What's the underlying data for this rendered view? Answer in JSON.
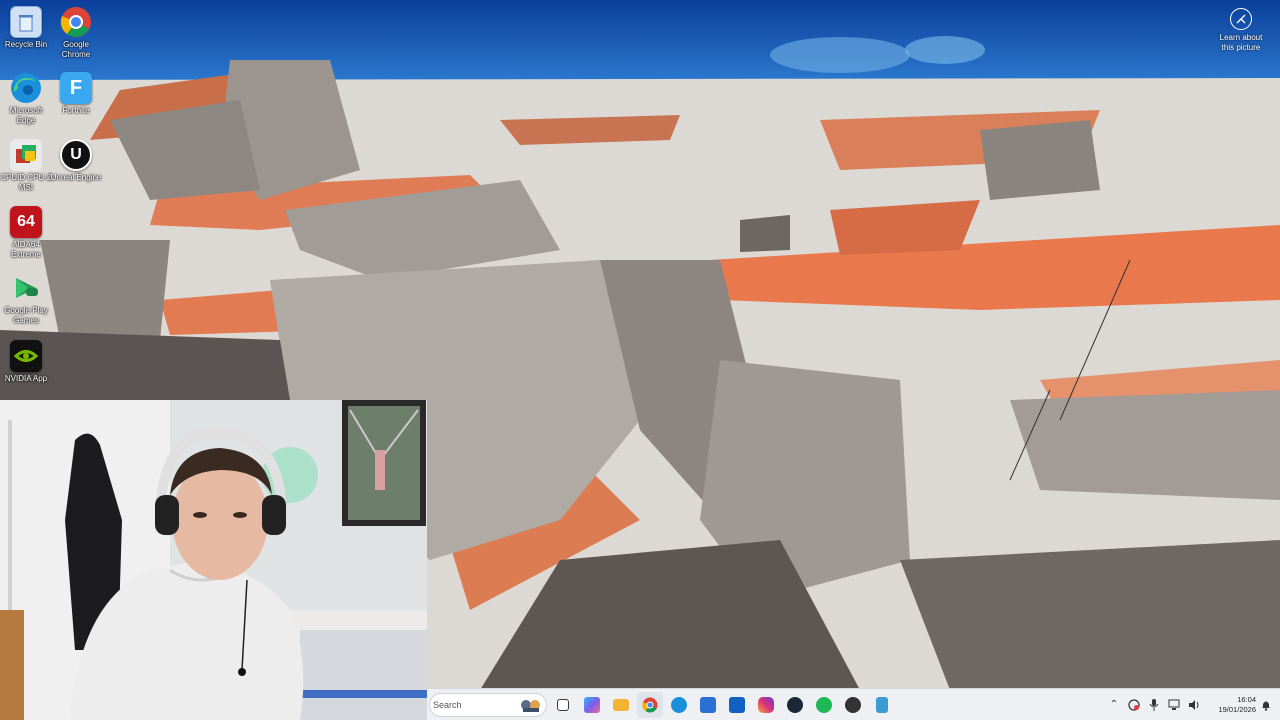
{
  "desktop": {
    "icons": [
      {
        "label": "Recycle Bin",
        "icon": "recycle-bin-icon",
        "color": "#5a8fd6"
      },
      {
        "label": "Google Chrome",
        "icon": "chrome-icon",
        "color": "#db4437"
      },
      {
        "label": "Microsoft Edge",
        "icon": "edge-icon",
        "color": "#1a8fdb"
      },
      {
        "label": "Fortnite",
        "icon": "fortnite-icon",
        "color": "#3aa8f0"
      },
      {
        "label": "CPUID CPU-Z MSI",
        "icon": "cpuz-icon",
        "color": "#c0392b"
      },
      {
        "label": "Unreal Engine",
        "icon": "unreal-engine-icon",
        "color": "#111111"
      },
      {
        "label": "AIDA64 Extreme",
        "icon": "aida64-icon",
        "color": "#c0131b"
      },
      {
        "label": "Google Play Games",
        "icon": "google-play-games-icon",
        "color": "#2b9a57"
      },
      {
        "label": "NVIDIA App",
        "icon": "nvidia-icon",
        "color": "#111111"
      }
    ],
    "aida_glyph": "64",
    "learn_about": {
      "label": "Learn about this picture",
      "icon": "camera-icon"
    }
  },
  "taskbar": {
    "search_placeholder": "Search",
    "apps": [
      {
        "name": "task-view",
        "icon": "task-view-icon",
        "color": "#3b3b3b"
      },
      {
        "name": "copilot",
        "icon": "copilot-icon",
        "color": "#7b5cf0"
      },
      {
        "name": "file-explorer",
        "icon": "folder-icon",
        "color": "#f2b233"
      },
      {
        "name": "chrome",
        "icon": "chrome-icon",
        "color": "#db4437"
      },
      {
        "name": "edge",
        "icon": "edge-icon",
        "color": "#1a8fdb"
      },
      {
        "name": "microsoft-store",
        "icon": "store-icon",
        "color": "#2a6fd4"
      },
      {
        "name": "outlook",
        "icon": "outlook-icon",
        "color": "#1160c2"
      },
      {
        "name": "instagram",
        "icon": "instagram-icon",
        "color": "#d6337a"
      },
      {
        "name": "steam",
        "icon": "steam-icon",
        "color": "#1b2838"
      },
      {
        "name": "spotify",
        "icon": "spotify-icon",
        "color": "#1db954"
      },
      {
        "name": "davinci-resolve",
        "icon": "davinci-resolve-icon",
        "color": "#333333"
      },
      {
        "name": "notepad",
        "icon": "notepad-icon",
        "color": "#3a9bd5"
      }
    ],
    "tray": {
      "icons": [
        "chevron-up-icon",
        "security-icon",
        "microphone-icon",
        "network-icon",
        "volume-icon"
      ],
      "time": "16:04",
      "date": "19/01/2026"
    }
  }
}
